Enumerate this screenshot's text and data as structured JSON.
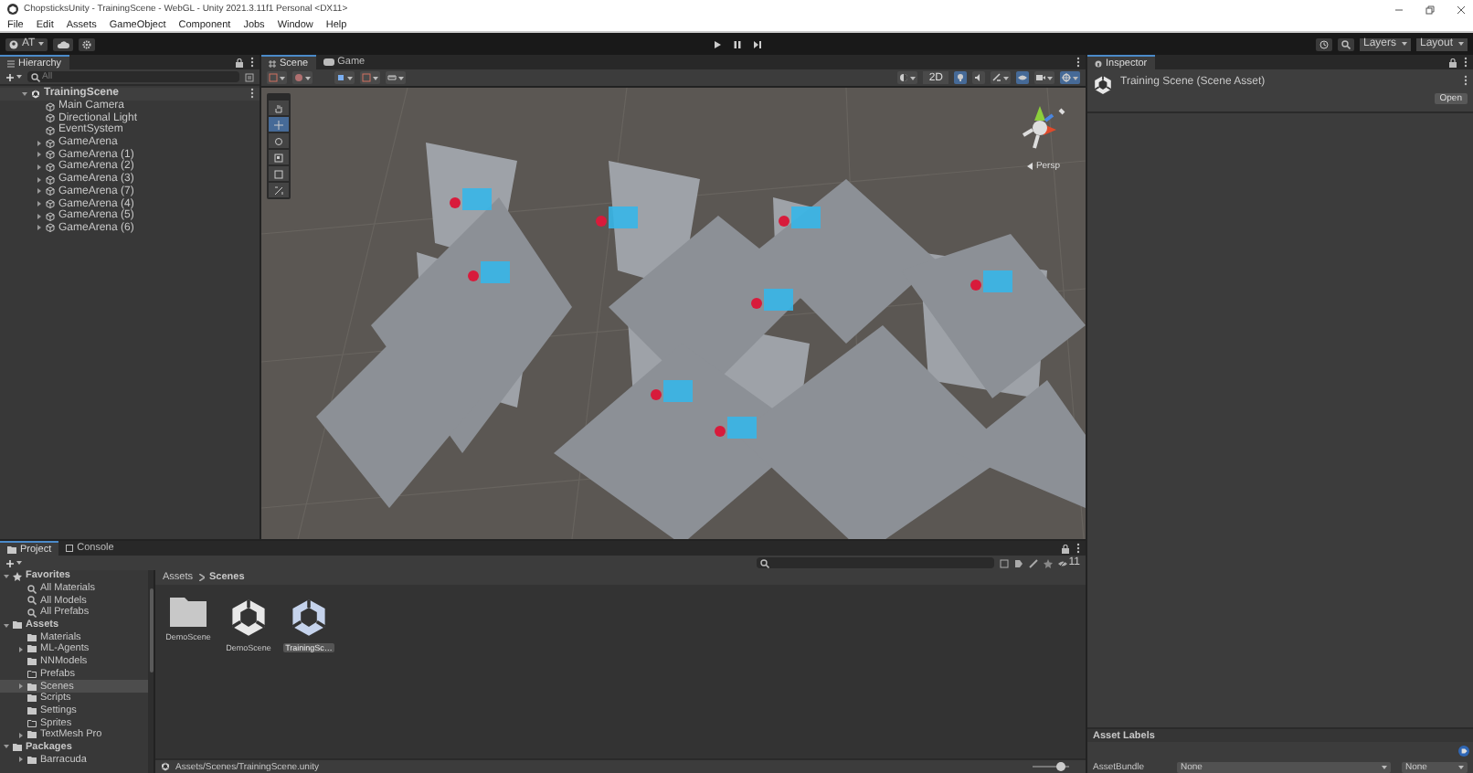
{
  "window": {
    "title": "ChopsticksUnity - TrainingScene - WebGL - Unity 2021.3.11f1 Personal <DX11>"
  },
  "menu": [
    "File",
    "Edit",
    "Assets",
    "GameObject",
    "Component",
    "Jobs",
    "Window",
    "Help"
  ],
  "toolbar": {
    "account": "AT",
    "layers": "Layers",
    "layout": "Layout"
  },
  "hierarchy": {
    "tab": "Hierarchy",
    "search": {
      "placeholder": "All"
    },
    "items": [
      {
        "label": "TrainingScene",
        "kind": "scene",
        "expanded": true,
        "children": [
          {
            "label": "Main Camera",
            "kind": "object"
          },
          {
            "label": "Directional Light",
            "kind": "object"
          },
          {
            "label": "EventSystem",
            "kind": "object"
          },
          {
            "label": "GameArena",
            "kind": "object",
            "expanded": false
          },
          {
            "label": "GameArena (1)",
            "kind": "object",
            "expanded": false
          },
          {
            "label": "GameArena (2)",
            "kind": "object",
            "expanded": false
          },
          {
            "label": "GameArena (3)",
            "kind": "object",
            "expanded": false
          },
          {
            "label": "GameArena (7)",
            "kind": "object",
            "expanded": false
          },
          {
            "label": "GameArena (4)",
            "kind": "object",
            "expanded": false
          },
          {
            "label": "GameArena (5)",
            "kind": "object",
            "expanded": false
          },
          {
            "label": "GameArena (6)",
            "kind": "object",
            "expanded": false
          }
        ]
      }
    ]
  },
  "scene": {
    "tabs": [
      {
        "label": "Scene",
        "selected": true
      },
      {
        "label": "Game",
        "selected": false
      }
    ],
    "mode_2d": "2D",
    "projection": "Persp"
  },
  "inspector": {
    "tab": "Inspector",
    "asset_title": "Training Scene (Scene Asset)",
    "open_button": "Open",
    "labels_header": "Asset Labels",
    "asset_bundle": {
      "label": "AssetBundle",
      "name": "None",
      "variant": "None"
    }
  },
  "project": {
    "tabs": [
      {
        "label": "Project",
        "selected": true
      },
      {
        "label": "Console",
        "selected": false
      }
    ],
    "tree": [
      {
        "label": "Favorites",
        "kind": "star",
        "expanded": true,
        "selected": false,
        "children": [
          {
            "label": "All Materials",
            "kind": "search",
            "selected": false
          },
          {
            "label": "All Models",
            "kind": "search",
            "selected": false
          },
          {
            "label": "All Prefabs",
            "kind": "search",
            "selected": false
          }
        ]
      },
      {
        "label": "Assets",
        "kind": "folder",
        "expanded": true,
        "selected": false,
        "children": [
          {
            "label": "Materials",
            "kind": "folder",
            "selected": false
          },
          {
            "label": "ML-Agents",
            "kind": "folder",
            "expanded": false,
            "selected": false
          },
          {
            "label": "NNModels",
            "kind": "folder",
            "selected": false
          },
          {
            "label": "Prefabs",
            "kind": "empty-folder",
            "selected": false
          },
          {
            "label": "Scenes",
            "kind": "folder",
            "expanded": false,
            "selected": true
          },
          {
            "label": "Scripts",
            "kind": "folder",
            "selected": false
          },
          {
            "label": "Settings",
            "kind": "folder",
            "selected": false
          },
          {
            "label": "Sprites",
            "kind": "empty-folder",
            "selected": false
          },
          {
            "label": "TextMesh Pro",
            "kind": "folder",
            "expanded": false,
            "selected": false
          }
        ]
      },
      {
        "label": "Packages",
        "kind": "folder",
        "expanded": true,
        "selected": false,
        "children": [
          {
            "label": "Barracuda",
            "kind": "folder",
            "expanded": false,
            "selected": false
          }
        ]
      }
    ],
    "breadcrumb": [
      "Assets",
      "Scenes"
    ],
    "items": [
      {
        "label": "DemoScene",
        "kind": "folder",
        "selected": false
      },
      {
        "label": "DemoScene",
        "kind": "scene",
        "selected": false
      },
      {
        "label": "TrainingSc…",
        "kind": "scene",
        "selected": true
      }
    ],
    "hidden_count": "11",
    "path": "Assets/Scenes/TrainingScene.unity",
    "zoom_slider": {
      "level": 0.75
    }
  }
}
